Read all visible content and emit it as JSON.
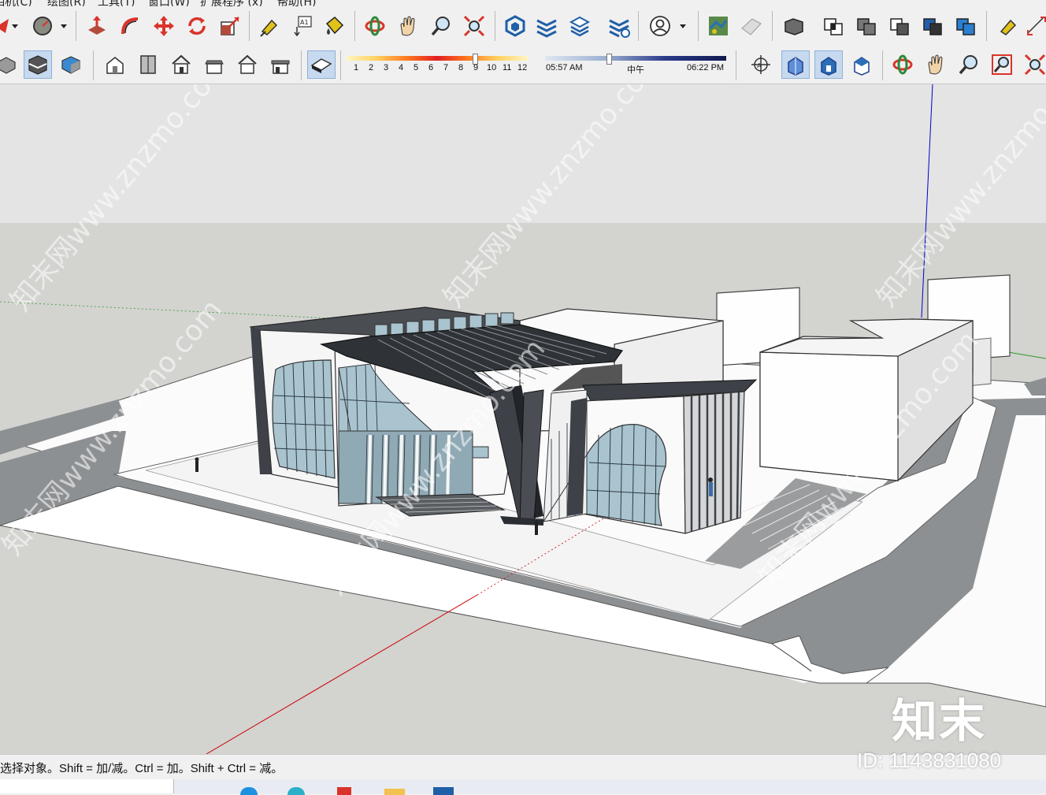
{
  "menu": {
    "items": [
      "相机(C)",
      "绘图(R)",
      "工具(T)",
      "窗口(W)",
      "扩展程序 (x)",
      "帮助(H)"
    ]
  },
  "toolbar_top": {
    "icons": [
      "arrow-icon",
      "dropdown-icon",
      "circle-tool-icon",
      "dropdown-icon",
      "push-pull-icon",
      "follow-me-icon",
      "move-icon",
      "rotate-icon",
      "scale-icon",
      "tape-measure-icon",
      "text-icon",
      "paint-bucket-icon",
      "orbit-icon",
      "pan-icon",
      "zoom-icon",
      "zoom-extents-icon",
      "3d-warehouse-icon",
      "extension-warehouse-icon",
      "layout-icon",
      "extension-manager-icon",
      "account-icon",
      "dropdown-icon",
      "add-location-icon",
      "toggle-terrain-icon",
      "outer-shell-icon",
      "intersect-icon",
      "union-icon",
      "subtract-icon",
      "trim-icon",
      "split-icon",
      "tape-measure-icon",
      "dimension-icon"
    ]
  },
  "toolbar_bottom": {
    "icons": [
      "xray-icon",
      "wireframe-icon",
      "shaded-icon",
      "iso-view-icon",
      "top-view-icon",
      "front-view-icon",
      "right-view-icon",
      "back-view-icon",
      "left-view-icon",
      "shadows-toggle-icon",
      "section-plane-icon",
      "walk-icon",
      "look-around-icon",
      "position-camera-icon",
      "orbit-icon",
      "pan-icon",
      "zoom-icon",
      "zoom-window-icon",
      "zoom-extents-icon"
    ],
    "month_scale": [
      "1",
      "2",
      "3",
      "4",
      "5",
      "6",
      "7",
      "8",
      "9",
      "10",
      "11",
      "12"
    ],
    "time_start": "05:57 AM",
    "time_mid": "中午",
    "time_end": "06:22 PM"
  },
  "status": {
    "text": "选择对象。Shift = 加/减。Ctrl = 加。Shift + Ctrl = 减。"
  },
  "watermark": {
    "logo": "知末",
    "id": "ID: 1143831080",
    "diagonal": "知末网www.znzmo.com"
  },
  "colors": {
    "sky": "#e3e3e3",
    "ground": "#d3d3d0",
    "road": "#8c8f92",
    "roof": "#3e4248",
    "glass": "#a9c4cf",
    "axis_red": "#cc0000",
    "axis_green": "#2a9a2a",
    "axis_blue": "#0000cc"
  }
}
